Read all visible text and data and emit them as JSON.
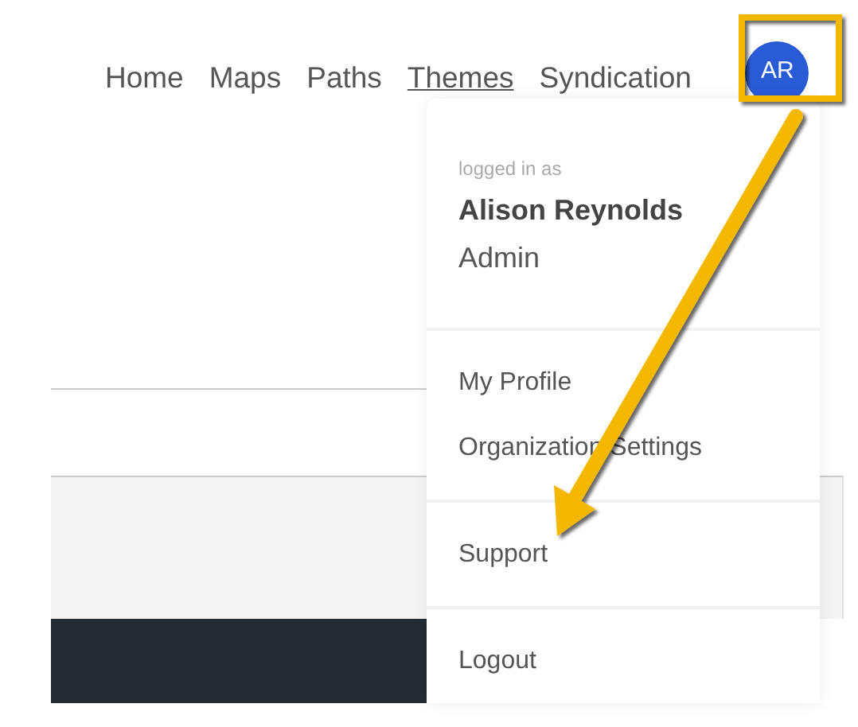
{
  "nav": [
    {
      "label": "Home",
      "selected": false
    },
    {
      "label": "Maps",
      "selected": false
    },
    {
      "label": "Paths",
      "selected": false
    },
    {
      "label": "Themes",
      "selected": true
    },
    {
      "label": "Syndication",
      "selected": false
    }
  ],
  "avatar": {
    "initials": "AR"
  },
  "user_menu": {
    "caption": "logged in as",
    "name": "Alison Reynolds",
    "role": "Admin",
    "groups": [
      [
        "My Profile",
        "Organization Settings"
      ],
      [
        "Support"
      ],
      [
        "Logout"
      ]
    ]
  }
}
